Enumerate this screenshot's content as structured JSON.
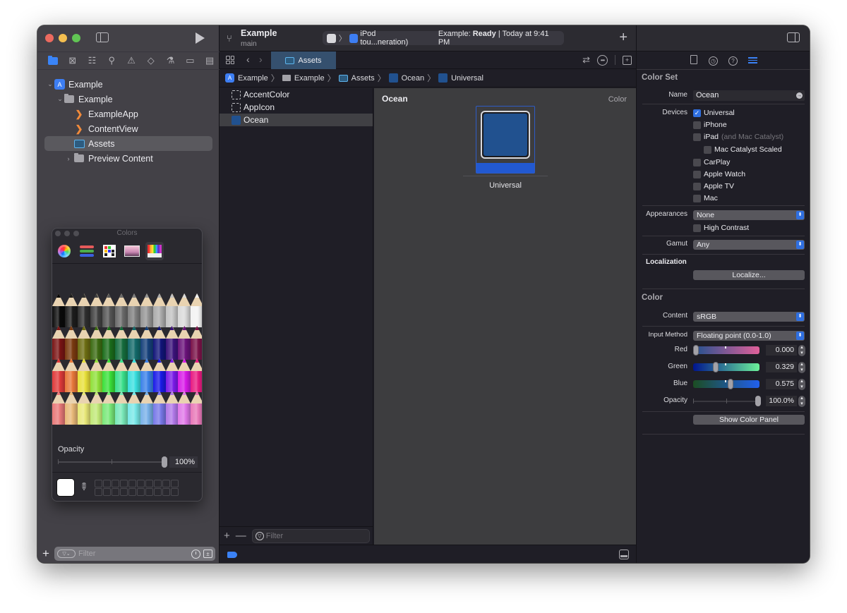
{
  "window": {
    "project_name": "Example",
    "branch": "main",
    "activity": {
      "destination": "iPod tou...neration)",
      "status_prefix": "Example: ",
      "status_bold": "Ready",
      "status_suffix": " | Today at 9:41 PM"
    }
  },
  "navigator": {
    "tabs": [
      "project-navigator",
      "source-control-navigator",
      "symbol-navigator",
      "find-navigator",
      "issue-navigator",
      "test-navigator",
      "debug-navigator",
      "breakpoint-navigator",
      "report-navigator"
    ],
    "tree": [
      {
        "label": "Example",
        "type": "project",
        "expanded": true,
        "depth": 0
      },
      {
        "label": "Example",
        "type": "folder",
        "expanded": true,
        "depth": 1
      },
      {
        "label": "ExampleApp",
        "type": "swift",
        "depth": 2
      },
      {
        "label": "ContentView",
        "type": "swift",
        "depth": 2
      },
      {
        "label": "Assets",
        "type": "assets",
        "depth": 2,
        "selected": true
      },
      {
        "label": "Preview Content",
        "type": "folder",
        "expanded": false,
        "depth": 2
      }
    ],
    "filter_placeholder": "Filter"
  },
  "colors_panel": {
    "title": "Colors",
    "modes": [
      "color-wheel",
      "color-sliders",
      "color-palettes",
      "image-palettes",
      "pencils"
    ],
    "active_mode": "pencils",
    "opacity_label": "Opacity",
    "opacity_value": "100%",
    "pencil_rows": [
      [
        "#0a0a0a",
        "#1c1c1c",
        "#2e2e2e",
        "#404040",
        "#555555",
        "#6a6a6a",
        "#7f7f7f",
        "#959595",
        "#ababab",
        "#c2c2c2",
        "#d9d9d9",
        "#f2f2f2"
      ],
      [
        "#7a1414",
        "#7a3a10",
        "#6d6d12",
        "#3b6a12",
        "#1b6d1b",
        "#156c3d",
        "#136a6a",
        "#15407a",
        "#12157a",
        "#3b127a",
        "#6a127a",
        "#7a1248"
      ],
      [
        "#e03a3a",
        "#e8783a",
        "#e8e03a",
        "#90e03a",
        "#3ae03a",
        "#3ae08c",
        "#3ae0e0",
        "#3a80e8",
        "#1a1ae8",
        "#7a1ae8",
        "#d81ae8",
        "#e81a80"
      ],
      [
        "#e87878",
        "#e8b878",
        "#e8e878",
        "#c0e878",
        "#78e878",
        "#78e8b8",
        "#78e8e8",
        "#78b0e8",
        "#7878e8",
        "#b078e8",
        "#e078e8",
        "#e878b8"
      ]
    ]
  },
  "editor": {
    "tab_label": "Assets",
    "breadcrumb": [
      "Example",
      "Example",
      "Assets",
      "Ocean",
      "Universal"
    ]
  },
  "asset_list": {
    "items": [
      {
        "label": "AccentColor",
        "type": "empty-color"
      },
      {
        "label": "AppIcon",
        "type": "empty-icon"
      },
      {
        "label": "Ocean",
        "type": "color",
        "selected": true
      }
    ],
    "filter_placeholder": "Filter"
  },
  "asset_detail": {
    "title": "Ocean",
    "kind": "Color",
    "well_label": "Universal",
    "color": "#21518f"
  },
  "inspector": {
    "tabs": [
      "file-inspector",
      "history-inspector",
      "quick-help-inspector",
      "attributes-inspector"
    ],
    "active_tab": "attributes-inspector",
    "color_set_header": "Color Set",
    "name_label": "Name",
    "name_value": "Ocean",
    "devices_label": "Devices",
    "devices": [
      {
        "label": "Universal",
        "checked": true
      },
      {
        "label": "iPhone",
        "checked": false
      },
      {
        "label": "iPad",
        "note": "(and Mac Catalyst)",
        "checked": false
      },
      {
        "label": "Mac Catalyst Scaled",
        "checked": false,
        "indent": true
      },
      {
        "label": "CarPlay",
        "checked": false
      },
      {
        "label": "Apple Watch",
        "checked": false
      },
      {
        "label": "Apple TV",
        "checked": false
      },
      {
        "label": "Mac",
        "checked": false
      }
    ],
    "appearances_label": "Appearances",
    "appearances_value": "None",
    "high_contrast_label": "High Contrast",
    "high_contrast_checked": false,
    "gamut_label": "Gamut",
    "gamut_value": "Any",
    "localization_label": "Localization",
    "localize_button": "Localize...",
    "color_header": "Color",
    "content_label": "Content",
    "content_value": "sRGB",
    "input_method_label": "Input Method",
    "input_method_value": "Floating point (0.0-1.0)",
    "components": [
      {
        "label": "Red",
        "value": "0.000",
        "fraction": 0.0
      },
      {
        "label": "Green",
        "value": "0.329",
        "fraction": 0.329
      },
      {
        "label": "Blue",
        "value": "0.575",
        "fraction": 0.575
      }
    ],
    "opacity_label": "Opacity",
    "opacity_value": "100.0%",
    "opacity_fraction": 1.0,
    "show_color_panel_button": "Show Color Panel"
  }
}
